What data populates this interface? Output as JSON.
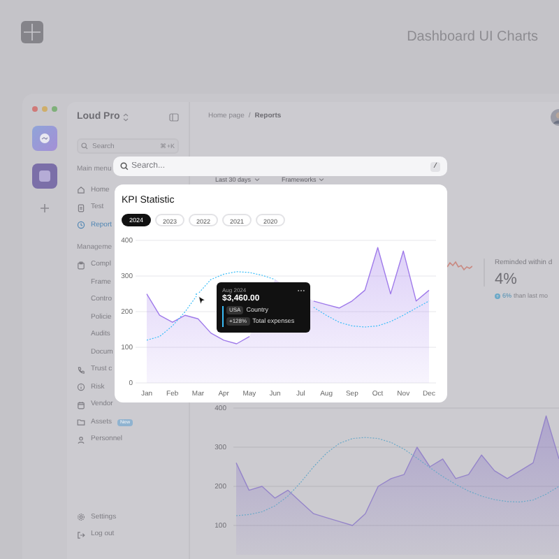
{
  "header": {
    "title": "Dashboard UI Charts"
  },
  "app": {
    "sidebar": {
      "workspace": "Loud Pro",
      "search": {
        "placeholder": "Search",
        "shortcut": "⌘+K"
      },
      "sections": [
        {
          "title": "Main menu",
          "items": [
            {
              "label": "Home",
              "selected": false
            },
            {
              "label": "Test",
              "selected": false
            },
            {
              "label": "Report",
              "selected": true
            }
          ]
        },
        {
          "title": "Manageme",
          "items": [
            {
              "label": "Compl",
              "selected": false,
              "children": [
                {
                  "label": "Frame",
                  "selected": false
                },
                {
                  "label": "Contro",
                  "selected": false
                },
                {
                  "label": "Policie",
                  "selected": false
                },
                {
                  "label": "Audits",
                  "selected": false
                },
                {
                  "label": "Docum",
                  "selected": false
                }
              ]
            },
            {
              "label": "Trust c",
              "selected": false
            },
            {
              "label": "Risk",
              "selected": false
            },
            {
              "label": "Vendor",
              "selected": false
            },
            {
              "label": "Assets",
              "selected": false,
              "badge": "New"
            },
            {
              "label": "Personnel",
              "selected": false
            }
          ]
        }
      ],
      "footer": [
        {
          "label": "Settings"
        },
        {
          "label": "Log out"
        }
      ]
    },
    "breadcrumb": {
      "items": [
        "Home page",
        "Reports"
      ],
      "separator": "/"
    },
    "filters": [
      {
        "label": "Last 30 days"
      },
      {
        "label": "Frameworks"
      }
    ],
    "stat": {
      "label": "Reminded within d",
      "value": "4%",
      "change": "6%",
      "change_note": "than last mo"
    },
    "chart_data": {
      "type": "line",
      "categories": [
        null,
        null,
        null,
        null,
        null,
        null,
        null,
        null,
        null,
        null,
        null,
        null,
        null,
        null,
        null,
        null,
        null,
        null,
        null,
        null,
        null,
        null,
        null,
        null,
        null,
        null
      ],
      "ylim": [
        100,
        400
      ],
      "yticks": [
        100,
        200,
        300,
        400
      ],
      "grid": true,
      "series": [
        {
          "color": "#9585c9",
          "type": "area",
          "values": [
            260,
            190,
            200,
            170,
            190,
            160,
            130,
            120,
            110,
            100,
            130,
            200,
            220,
            230,
            300,
            250,
            270,
            220,
            230,
            280,
            240,
            220,
            240,
            260,
            380,
            270
          ]
        },
        {
          "color": "#6aa9c8",
          "line_style": "dashed",
          "values": [
            125,
            128,
            135,
            150,
            175,
            210,
            250,
            285,
            310,
            322,
            325,
            322,
            312,
            295,
            272,
            248,
            225,
            205,
            188,
            175,
            166,
            161,
            160,
            165,
            180,
            200
          ]
        }
      ]
    }
  },
  "search_bar": {
    "placeholder": "Search...",
    "shortcut": "/"
  },
  "kpi_card": {
    "title": "KPI Statistic",
    "years": [
      {
        "label": "2024",
        "selected": true
      },
      {
        "label": "2023",
        "selected": false
      },
      {
        "label": "2022",
        "selected": false
      },
      {
        "label": "2021",
        "selected": false
      },
      {
        "label": "2020",
        "selected": false
      }
    ],
    "chart_data": {
      "type": "line",
      "categories": [
        "Jan",
        null,
        "Feb",
        null,
        "Mar",
        null,
        "Apr",
        null,
        "May",
        null,
        "Jun",
        null,
        "Jul",
        null,
        "Aug",
        null,
        "Sep",
        null,
        "Oct",
        null,
        "Nov",
        null,
        "Dec"
      ],
      "ylim": [
        0,
        400
      ],
      "yticks": [
        0,
        100,
        200,
        300,
        400
      ],
      "grid": true,
      "series": [
        {
          "color": "#9f7aea",
          "type": "area",
          "values": [
            250,
            190,
            170,
            190,
            180,
            140,
            120,
            110,
            130,
            null,
            290,
            null,
            null,
            230,
            220,
            210,
            230,
            260,
            380,
            250,
            370,
            230,
            260
          ]
        },
        {
          "color": "#38bdf8",
          "line_style": "dashed",
          "values": [
            120,
            130,
            160,
            200,
            250,
            290,
            305,
            312,
            310,
            302,
            290,
            null,
            null,
            212,
            190,
            170,
            160,
            157,
            160,
            172,
            190,
            210,
            230
          ]
        }
      ]
    },
    "tooltip": {
      "date": "Aug 2024",
      "amount": "$3,460.00",
      "rows": [
        {
          "badge": "USA",
          "label": "Country"
        },
        {
          "badge": "+128%",
          "label": "Total expenses"
        }
      ]
    }
  }
}
